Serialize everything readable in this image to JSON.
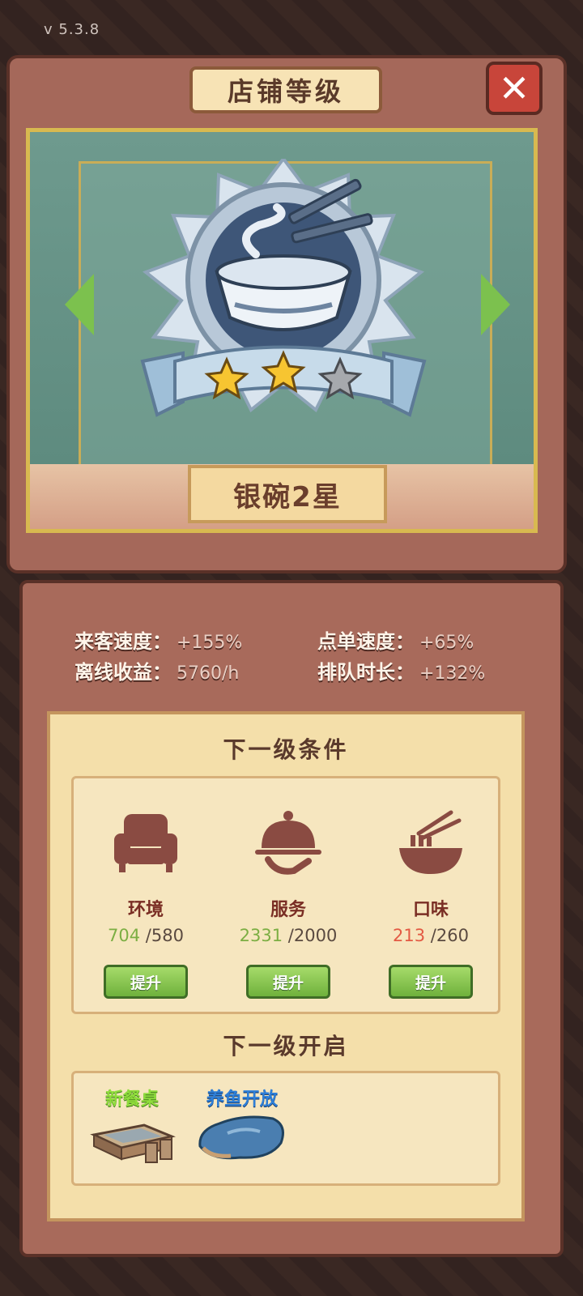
{
  "version": "v 5.3.8",
  "title": "店铺等级",
  "rank_label": "银碗2星",
  "stars_filled": 2,
  "stars_total": 3,
  "stats": {
    "customer_speed_label": "来客速度：",
    "customer_speed_value": "+155%",
    "order_speed_label": "点单速度：",
    "order_speed_value": "+65%",
    "offline_income_label": "离线收益：",
    "offline_income_value": "5760/h",
    "queue_time_label": "排队时长：",
    "queue_time_value": "+132%"
  },
  "next_level_conditions": {
    "heading": "下一级条件",
    "items": [
      {
        "name": "环境",
        "current": "704",
        "required": "/580",
        "button": "提升",
        "icon": "armchair-icon",
        "status": "met"
      },
      {
        "name": "服务",
        "current": "2331",
        "required": "/2000",
        "button": "提升",
        "icon": "serving-cloche-icon",
        "status": "met"
      },
      {
        "name": "口味",
        "current": "213",
        "required": "/260",
        "button": "提升",
        "icon": "noodle-bowl-icon",
        "status": "unmet"
      }
    ]
  },
  "next_level_unlocks": {
    "heading": "下一级开启",
    "items": [
      {
        "label": "新餐桌",
        "icon": "dining-table-icon"
      },
      {
        "label": "养鱼开放",
        "icon": "fish-pond-icon"
      }
    ]
  },
  "colors": {
    "met": "#7cae43",
    "unmet": "#e35a44",
    "button_green": "#6fb13c",
    "panel_brown": "#a86a5b"
  }
}
